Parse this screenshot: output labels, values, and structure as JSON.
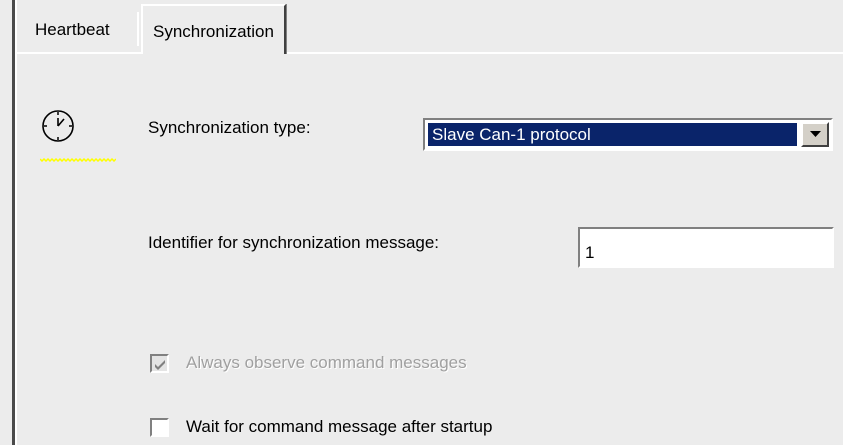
{
  "tabs": [
    {
      "label": "Heartbeat",
      "active": false
    },
    {
      "label": "Synchronization",
      "active": true
    }
  ],
  "icon": {
    "name": "clock-icon"
  },
  "sync_type": {
    "label": "Synchronization type:",
    "selected": "Slave Can-1 protocol"
  },
  "identifier": {
    "label": "Identifier for synchronization message:",
    "value": "1"
  },
  "checkboxes": [
    {
      "label": "Always observe command messages",
      "checked": true,
      "enabled": false
    },
    {
      "label": "Wait for command message after startup",
      "checked": false,
      "enabled": true
    }
  ],
  "colors": {
    "selection": "#0a246a",
    "clock_underline": "#ffff00"
  }
}
